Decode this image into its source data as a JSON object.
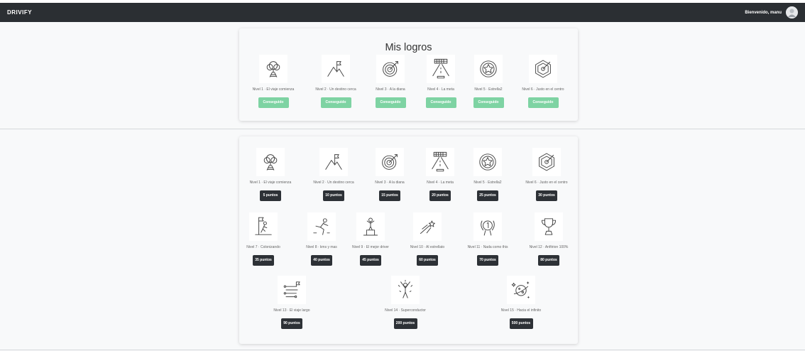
{
  "navbar": {
    "brand": "DRIVIFY",
    "welcome": "Bienvenido, manu"
  },
  "achieved": {
    "title": "Mis logros",
    "items": [
      {
        "label": "Nivel 1 · El viaje comienza",
        "status": "Conseguido",
        "icon": "tree-road-icon"
      },
      {
        "label": "Nivel 2 · Un destino cerca",
        "status": "Conseguido",
        "icon": "mountain-flag-icon"
      },
      {
        "label": "Nivel 3 · A la diana",
        "status": "Conseguido",
        "icon": "target-arrow-icon"
      },
      {
        "label": "Nivel 4 · La meta",
        "status": "Conseguido",
        "icon": "finish-line-icon"
      },
      {
        "label": "Nivel 5 · Estrella2",
        "status": "Conseguido",
        "icon": "star-badge-icon"
      },
      {
        "label": "Nivel 6 · Justo en el centro",
        "status": "Conseguido",
        "icon": "bullseye-icon"
      }
    ]
  },
  "levels": {
    "items": [
      {
        "label": "Nivel 1 · El viaje comienza",
        "points": "5 puntos",
        "icon": "tree-road-icon"
      },
      {
        "label": "Nivel 2 · Un destino cerca",
        "points": "10 puntos",
        "icon": "mountain-flag-icon"
      },
      {
        "label": "Nivel 3 · A la diana",
        "points": "15 puntos",
        "icon": "target-arrow-icon"
      },
      {
        "label": "Nivel 4 · La meta",
        "points": "20 puntos",
        "icon": "finish-line-icon"
      },
      {
        "label": "Nivel 5 · Estrella2",
        "points": "25 puntos",
        "icon": "star-badge-icon"
      },
      {
        "label": "Nivel 6 · Justo en el centro",
        "points": "30 puntos",
        "icon": "bullseye-icon"
      },
      {
        "label": "Nivel 7 · Colonizando",
        "points": "35 puntos",
        "icon": "climber-flag-icon"
      },
      {
        "label": "Nivel 8 · kms y mas",
        "points": "40 puntos",
        "icon": "runner-icon"
      },
      {
        "label": "Nivel 9 · El mejor driver",
        "points": "45 puntos",
        "icon": "podium-icon"
      },
      {
        "label": "Nivel 10 · Al estrellato",
        "points": "60 puntos",
        "icon": "shooting-star-icon"
      },
      {
        "label": "Nivel 11 · Nada como this",
        "points": "70 puntos",
        "icon": "laurel-medal-icon"
      },
      {
        "label": "Nivel 12 · Anfitrion 100%",
        "points": "80 puntos",
        "icon": "trophy-icon"
      },
      {
        "label": "Nivel 13 · El viaje largo",
        "points": "90 puntos",
        "icon": "winding-route-icon"
      },
      {
        "label": "Nivel 14 · Superconductor",
        "points": "200 puntos",
        "icon": "celebrating-person-icon"
      },
      {
        "label": "Nivel 15 · Hacia el infinito",
        "points": "500 puntos",
        "icon": "planet-icon"
      }
    ]
  }
}
